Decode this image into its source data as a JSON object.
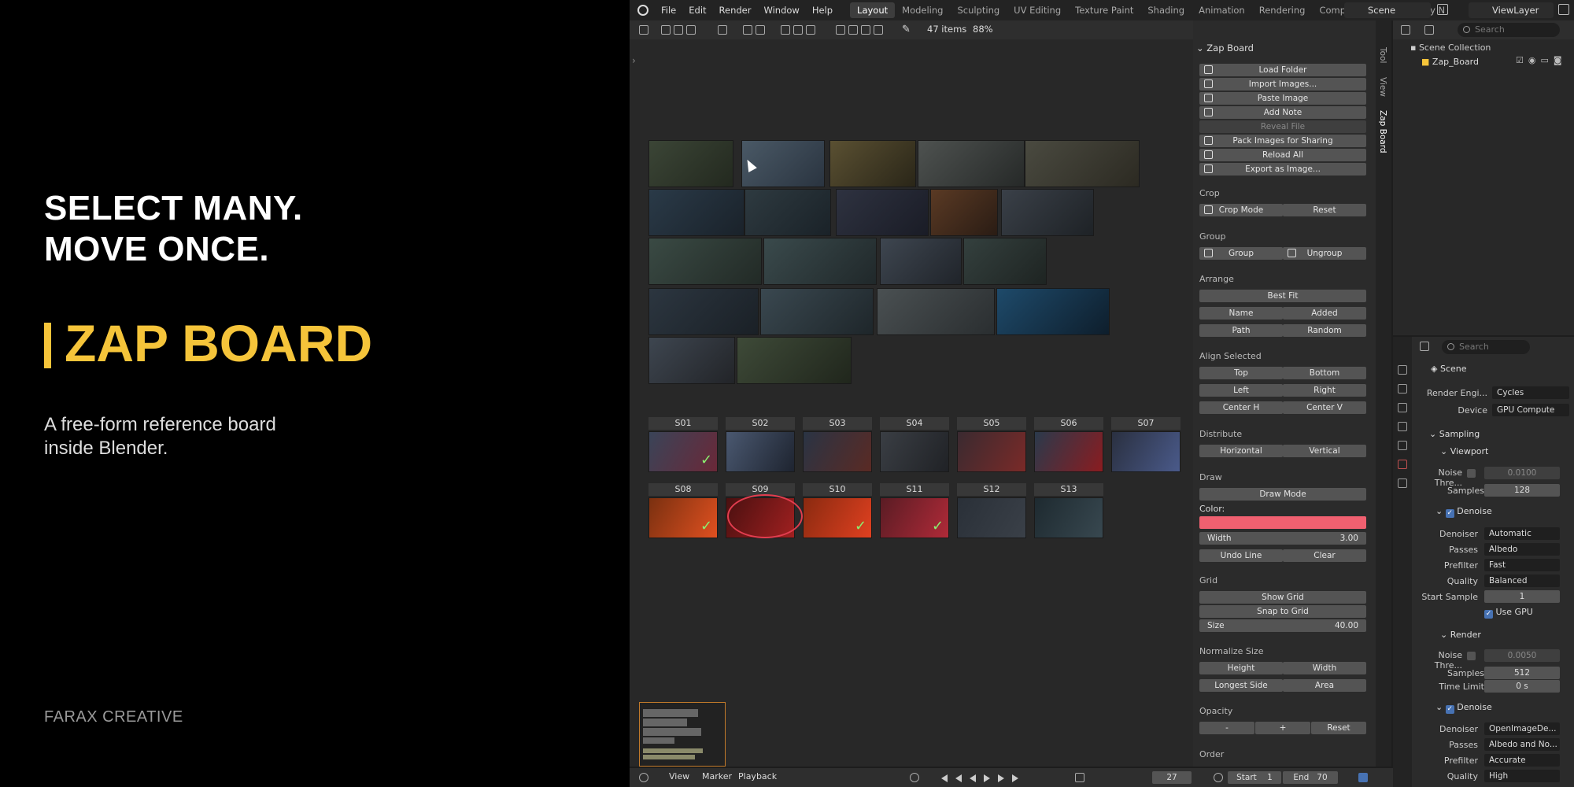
{
  "promo": {
    "headline_1": "SELECT MANY.",
    "headline_2": "MOVE ONCE.",
    "brand": "ZAP BOARD",
    "tagline_1": "A free-form reference board",
    "tagline_2": "inside Blender.",
    "studio": "FARAX CREATIVE",
    "accent_color": "#f5c43a"
  },
  "topbar": {
    "menus": [
      "File",
      "Edit",
      "Render",
      "Window",
      "Help"
    ],
    "workspaces": [
      "Layout",
      "Modeling",
      "Sculpting",
      "UV Editing",
      "Texture Paint",
      "Shading",
      "Animation",
      "Rendering",
      "Compositing",
      "Geometry N"
    ],
    "active_workspace": "Layout",
    "scene": "Scene",
    "view_layer": "ViewLayer"
  },
  "viewport": {
    "item_count": "47 items",
    "zoom": "88%",
    "shots_row1": [
      "S01",
      "S02",
      "S03",
      "S04",
      "S05",
      "S06",
      "S07"
    ],
    "shots_row2": [
      "S08",
      "S09",
      "S10",
      "S11",
      "S12",
      "S13"
    ]
  },
  "npanel": {
    "title": "Zap Board",
    "tabs": [
      "Tool",
      "View",
      "Zap Board"
    ],
    "actions": [
      "Load Folder",
      "Import Images...",
      "Paste Image",
      "Add Note",
      "Reveal File",
      "Pack Images for Sharing",
      "Reload All",
      "Export as Image..."
    ],
    "crop": {
      "label": "Crop",
      "mode": "Crop Mode",
      "reset": "Reset"
    },
    "group": {
      "label": "Group",
      "group": "Group",
      "ungroup": "Ungroup"
    },
    "arrange": {
      "label": "Arrange",
      "best_fit": "Best Fit",
      "name": "Name",
      "added": "Added",
      "path": "Path",
      "random": "Random"
    },
    "align": {
      "label": "Align Selected",
      "top": "Top",
      "bottom": "Bottom",
      "left": "Left",
      "right": "Right",
      "center_h": "Center H",
      "center_v": "Center V"
    },
    "distribute": {
      "label": "Distribute",
      "horizontal": "Horizontal",
      "vertical": "Vertical"
    },
    "draw": {
      "label": "Draw",
      "mode": "Draw Mode",
      "color_label": "Color:",
      "color": "#f06070",
      "width_label": "Width",
      "width": "3.00",
      "undo": "Undo Line",
      "clear": "Clear"
    },
    "grid": {
      "label": "Grid",
      "show": "Show Grid",
      "snap": "Snap to Grid",
      "size_label": "Size",
      "size": "40.00"
    },
    "normalize": {
      "label": "Normalize Size",
      "height": "Height",
      "width": "Width",
      "longest": "Longest Side",
      "area": "Area"
    },
    "opacity": {
      "label": "Opacity",
      "minus": "-",
      "plus": "+",
      "reset": "Reset"
    },
    "order": {
      "label": "Order"
    }
  },
  "outliner": {
    "search_placeholder": "Search",
    "collection": "Scene Collection",
    "object": "Zap_Board"
  },
  "properties": {
    "search_placeholder": "Search",
    "scene": "Scene",
    "render_engine_label": "Render Engi...",
    "render_engine": "Cycles",
    "device_label": "Device",
    "device": "GPU Compute",
    "sampling": "Sampling",
    "viewport": "Viewport",
    "noise_label": "Noise Thre...",
    "vp_noise": "0.0100",
    "samples_label": "Samples",
    "vp_samples": "128",
    "denoise": "Denoise",
    "denoiser_label": "Denoiser",
    "vp_denoiser": "Automatic",
    "passes_label": "Passes",
    "vp_passes": "Albedo",
    "prefilter_label": "Prefilter",
    "vp_prefilter": "Fast",
    "quality_label": "Quality",
    "vp_quality": "Balanced",
    "start_sample_label": "Start Sample",
    "vp_start_sample": "1",
    "use_gpu": "Use GPU",
    "render": "Render",
    "r_noise": "0.0050",
    "r_samples": "512",
    "time_limit_label": "Time Limit",
    "r_time_limit": "0 s",
    "r_denoiser": "OpenImageDe...",
    "r_passes": "Albedo and No...",
    "r_prefilter": "Accurate",
    "r_quality": "High"
  },
  "timeline": {
    "view": "View",
    "marker": "Marker",
    "playback": "Playback",
    "frame": "27",
    "start_label": "Start",
    "start": "1",
    "end_label": "End",
    "end": "70"
  }
}
